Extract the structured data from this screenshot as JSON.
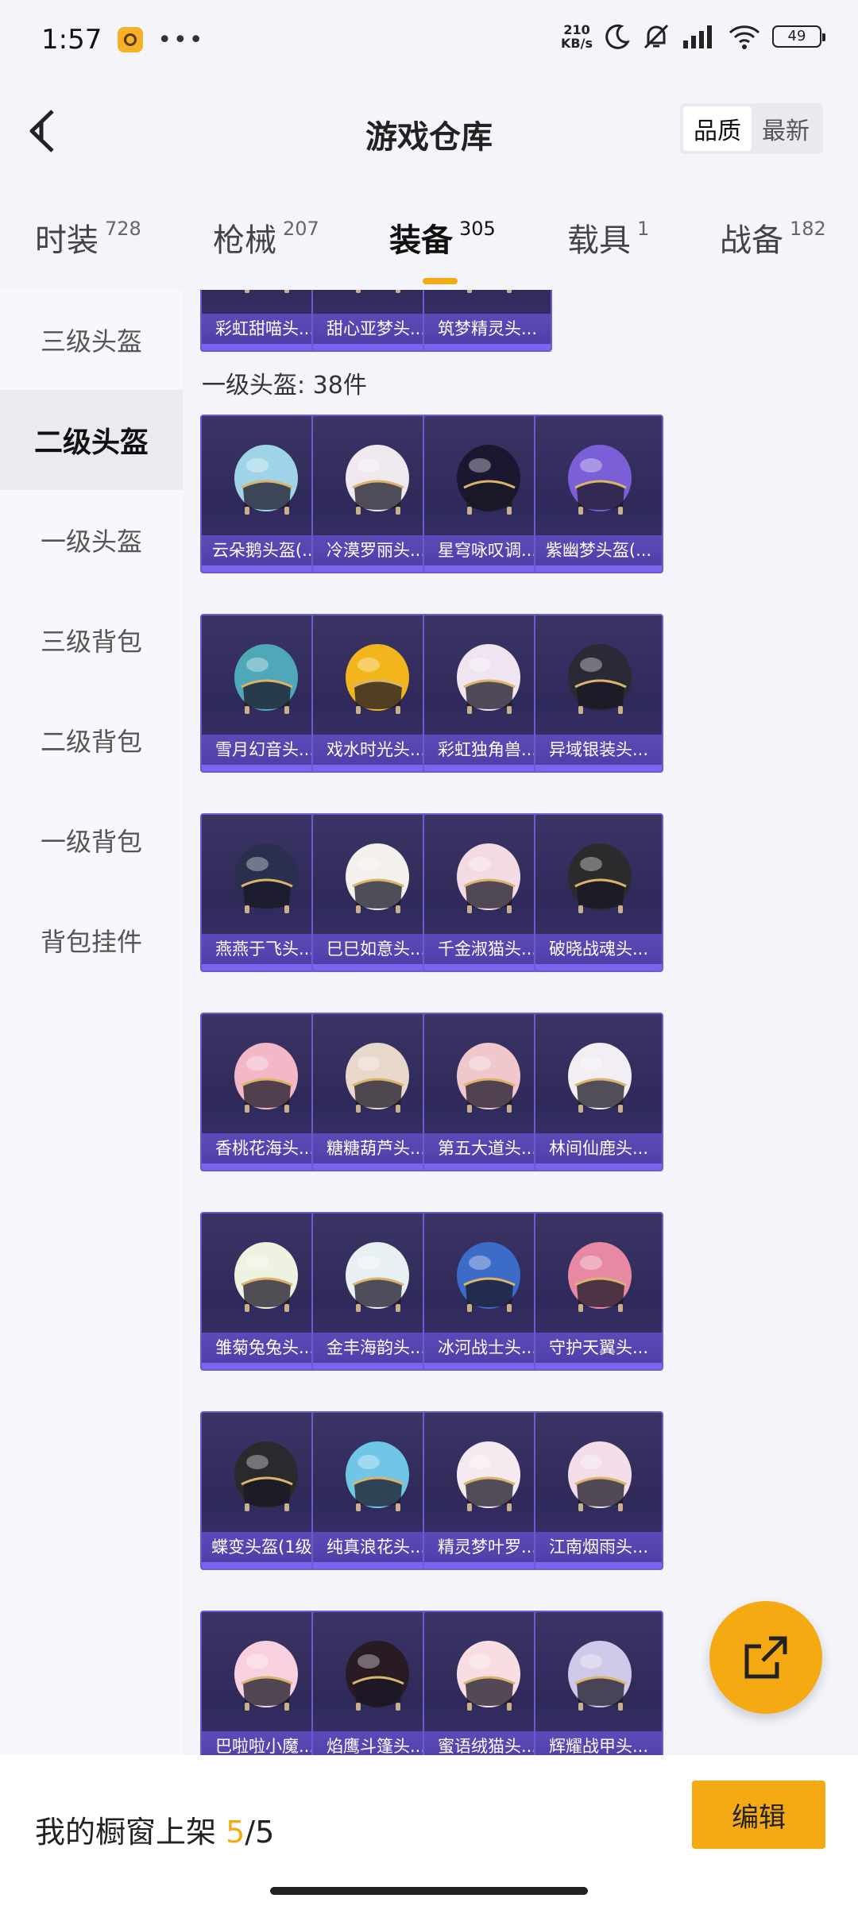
{
  "status_bar": {
    "time": "1:57",
    "app_icon": "app-notification-icon",
    "more": "•••",
    "net_speed_value": "210",
    "net_speed_unit": "KB/s",
    "battery": "49",
    "icons": [
      "moon-icon",
      "mute-icon",
      "signal-icon",
      "wifi-icon",
      "battery-icon"
    ]
  },
  "header": {
    "title": "游戏仓库",
    "sort": {
      "quality": "品质",
      "latest": "最新",
      "selected": "品质"
    }
  },
  "tabs": [
    {
      "label": "时装",
      "count": "728"
    },
    {
      "label": "枪械",
      "count": "207"
    },
    {
      "label": "装备",
      "count": "305",
      "active": true
    },
    {
      "label": "载具",
      "count": "1"
    },
    {
      "label": "战备",
      "count": "182"
    }
  ],
  "sidebar": {
    "items": [
      "三级头盔",
      "二级头盔",
      "一级头盔",
      "三级背包",
      "二级背包",
      "一级背包",
      "背包挂件"
    ],
    "active": "二级头盔"
  },
  "content": {
    "top_row": [
      "彩虹甜喵头...",
      "甜心亚梦头...",
      "筑梦精灵头..."
    ],
    "section_title": "一级头盔: 38件",
    "grid": [
      [
        "云朵鹅头盔(...",
        "冷漠罗丽头...",
        "星穹咏叹调...",
        "紫幽梦头盔(..."
      ],
      [
        "雪月幻音头...",
        "戏水时光头...",
        "彩虹独角兽...",
        "异域银装头..."
      ],
      [
        "燕燕于飞头...",
        "巳巳如意头...",
        "千金淑猫头...",
        "破晓战魂头..."
      ],
      [
        "香桃花海头...",
        "糖糖葫芦头...",
        "第五大道头...",
        "林间仙鹿头..."
      ],
      [
        "雏菊兔兔头...",
        "金丰海韵头...",
        "冰河战士头...",
        "守护天翼头..."
      ],
      [
        "蝶变头盔(1级)",
        "纯真浪花头...",
        "精灵梦叶罗...",
        "江南烟雨头..."
      ],
      [
        "巴啦啦小魔...",
        "焰鹰斗篷头...",
        "蜜语绒猫头...",
        "辉耀战甲头..."
      ]
    ]
  },
  "colors": {
    "accent": "#f5a913",
    "card_bg": "#2f2a5a",
    "card_border": "#6a5cd0",
    "helmet_colors": [
      [
        "#9fd4e8",
        "#efe8ee",
        "#1a1830",
        "#7b5fd6"
      ],
      [
        "#4fa8b8",
        "#f2b51c",
        "#f0e4f0",
        "#2a2a36"
      ],
      [
        "#2a2f4e",
        "#f3f0ee",
        "#f3dbe4",
        "#2b2b2e"
      ],
      [
        "#f2b8c8",
        "#e8d8cc",
        "#f0c8cc",
        "#f3eef4"
      ],
      [
        "#eef2e0",
        "#e8f0f4",
        "#3b6cc8",
        "#e889a4"
      ],
      [
        "#2a2a2e",
        "#6fc6e6",
        "#f5eaf0",
        "#f2dde8"
      ],
      [
        "#f8d0e0",
        "#2a1a24",
        "#f8dde2",
        "#d0c8e8"
      ]
    ],
    "top_row_colors": [
      "#efd4e4",
      "#f0e0ea",
      "#e8e4f4"
    ]
  },
  "fab_icon": "share-icon",
  "bottom": {
    "shelf_label": "我的橱窗上架",
    "shelf_current": "5",
    "shelf_total": "/5",
    "edit_label": "编辑"
  }
}
